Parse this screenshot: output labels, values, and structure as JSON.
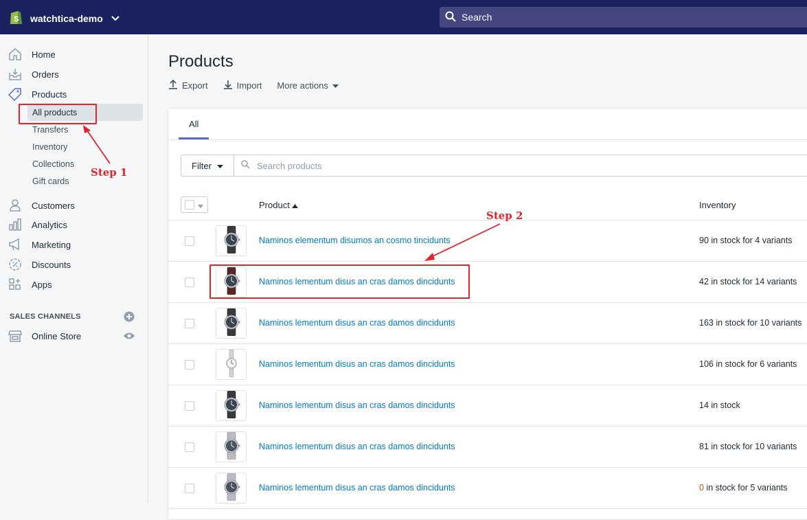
{
  "topbar": {
    "store_name": "watchtica-demo",
    "search_placeholder": "Search"
  },
  "sidebar": {
    "items": [
      {
        "label": "Home",
        "icon": "home-icon"
      },
      {
        "label": "Orders",
        "icon": "orders-icon"
      },
      {
        "label": "Products",
        "icon": "tag-icon"
      }
    ],
    "product_sub": [
      {
        "label": "All products"
      },
      {
        "label": "Transfers"
      },
      {
        "label": "Inventory"
      },
      {
        "label": "Collections"
      },
      {
        "label": "Gift cards"
      }
    ],
    "items2": [
      {
        "label": "Customers",
        "icon": "person-icon"
      },
      {
        "label": "Analytics",
        "icon": "bar-chart-icon"
      },
      {
        "label": "Marketing",
        "icon": "megaphone-icon"
      },
      {
        "label": "Discounts",
        "icon": "discount-icon"
      },
      {
        "label": "Apps",
        "icon": "apps-icon"
      }
    ],
    "sales_channels_label": "SALES CHANNELS",
    "online_store": "Online Store"
  },
  "page": {
    "title": "Products",
    "actions": {
      "export": "Export",
      "import": "Import",
      "more": "More actions"
    },
    "tab_all": "All",
    "filter_label": "Filter",
    "search_placeholder": "Search products",
    "col_product": "Product",
    "col_inventory": "Inventory"
  },
  "products": [
    {
      "name": "Naminos elementum disumos an cosmo tincidunts",
      "inv_num": "90",
      "inv_rest": " in stock for 4 variants",
      "watch": "dark-strap"
    },
    {
      "name": "Naminos lementum disus an cras damos dincidunts",
      "inv_num": "42",
      "inv_rest": " in stock for 14 variants",
      "watch": "brown-strap"
    },
    {
      "name": "Naminos lementum disus an cras damos dincidunts",
      "inv_num": "163",
      "inv_rest": " in stock for 10 variants",
      "watch": "dark-strap"
    },
    {
      "name": "Naminos lementum disus an cras damos dincidunts",
      "inv_num": "106",
      "inv_rest": " in stock for 6 variants",
      "watch": "silver-bracelet-thin"
    },
    {
      "name": "Naminos lementum disus an cras damos dincidunts",
      "inv_num": "14",
      "inv_rest": " in stock",
      "watch": "dark-strap"
    },
    {
      "name": "Naminos lementum disus an cras damos dincidunts",
      "inv_num": "81",
      "inv_rest": " in stock for 10 variants",
      "watch": "steel-bracelet"
    },
    {
      "name": "Naminos lementum disus an cras damos dincidunts",
      "inv_num": "0",
      "inv_rest": " in stock for 5 variants",
      "watch": "steel-bracelet",
      "zero": true
    }
  ],
  "annotations": {
    "step1": "Step 1",
    "step2": "Step 2"
  },
  "colors": {
    "topbar": "#1c2260",
    "link": "#007ace",
    "annotation": "#e5242a",
    "tab_underline": "#5c6ac4"
  }
}
